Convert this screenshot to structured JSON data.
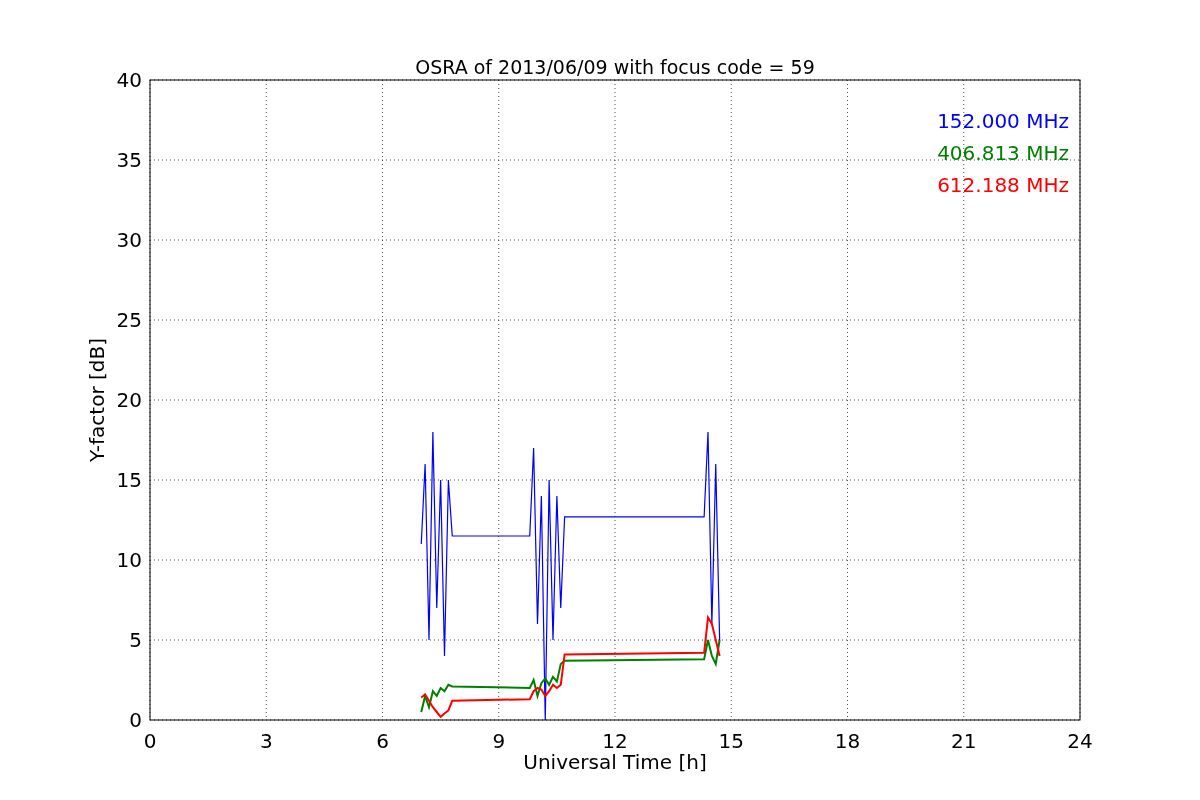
{
  "chart": {
    "chart_data": {
      "type": "line",
      "title": "OSRA of 2013/06/09 with focus code = 59",
      "xlabel": "Universal Time [h]",
      "ylabel": "Y-factor [dB]",
      "x": [
        7.0,
        7.1,
        7.2,
        7.3,
        7.4,
        7.5,
        7.6,
        7.7,
        7.8,
        9.8,
        9.9,
        10.0,
        10.1,
        10.2,
        10.3,
        10.4,
        10.5,
        10.6,
        10.7,
        14.3,
        14.4,
        14.5,
        14.6,
        14.7
      ],
      "series": [
        {
          "name": "152.000 MHz",
          "color": "#0000ff",
          "values": [
            11,
            16,
            5,
            18,
            7,
            15,
            4,
            15,
            11.5,
            11.5,
            17,
            6,
            14,
            0,
            15,
            5,
            14,
            7,
            12.7,
            12.7,
            18,
            6,
            16,
            5
          ]
        },
        {
          "name": "406.813 MHz",
          "color": "#008000",
          "values": [
            0.5,
            1.5,
            0.8,
            1.8,
            1.5,
            2,
            1.8,
            2.2,
            2.1,
            2.0,
            2.5,
            1.5,
            2.3,
            2.6,
            2.2,
            2.7,
            2.4,
            3.5,
            3.7,
            3.8,
            5,
            4,
            3.5,
            5
          ]
        },
        {
          "name": "612.188 MHz",
          "color": "#ff0000",
          "values": [
            1.4,
            1.6,
            1.2,
            0.8,
            0.5,
            0.2,
            0.4,
            0.6,
            1.2,
            1.3,
            1.8,
            2.0,
            1.9,
            1.5,
            1.8,
            2.2,
            2.0,
            2.2,
            4.1,
            4.2,
            6.4,
            6,
            5,
            4
          ]
        }
      ],
      "xlim": [
        0,
        24
      ],
      "ylim": [
        0,
        40
      ],
      "xticks": [
        0,
        3,
        6,
        9,
        12,
        15,
        18,
        21,
        24
      ],
      "yticks": [
        0,
        5,
        10,
        15,
        20,
        25,
        30,
        35,
        40
      ],
      "grid": true
    }
  }
}
